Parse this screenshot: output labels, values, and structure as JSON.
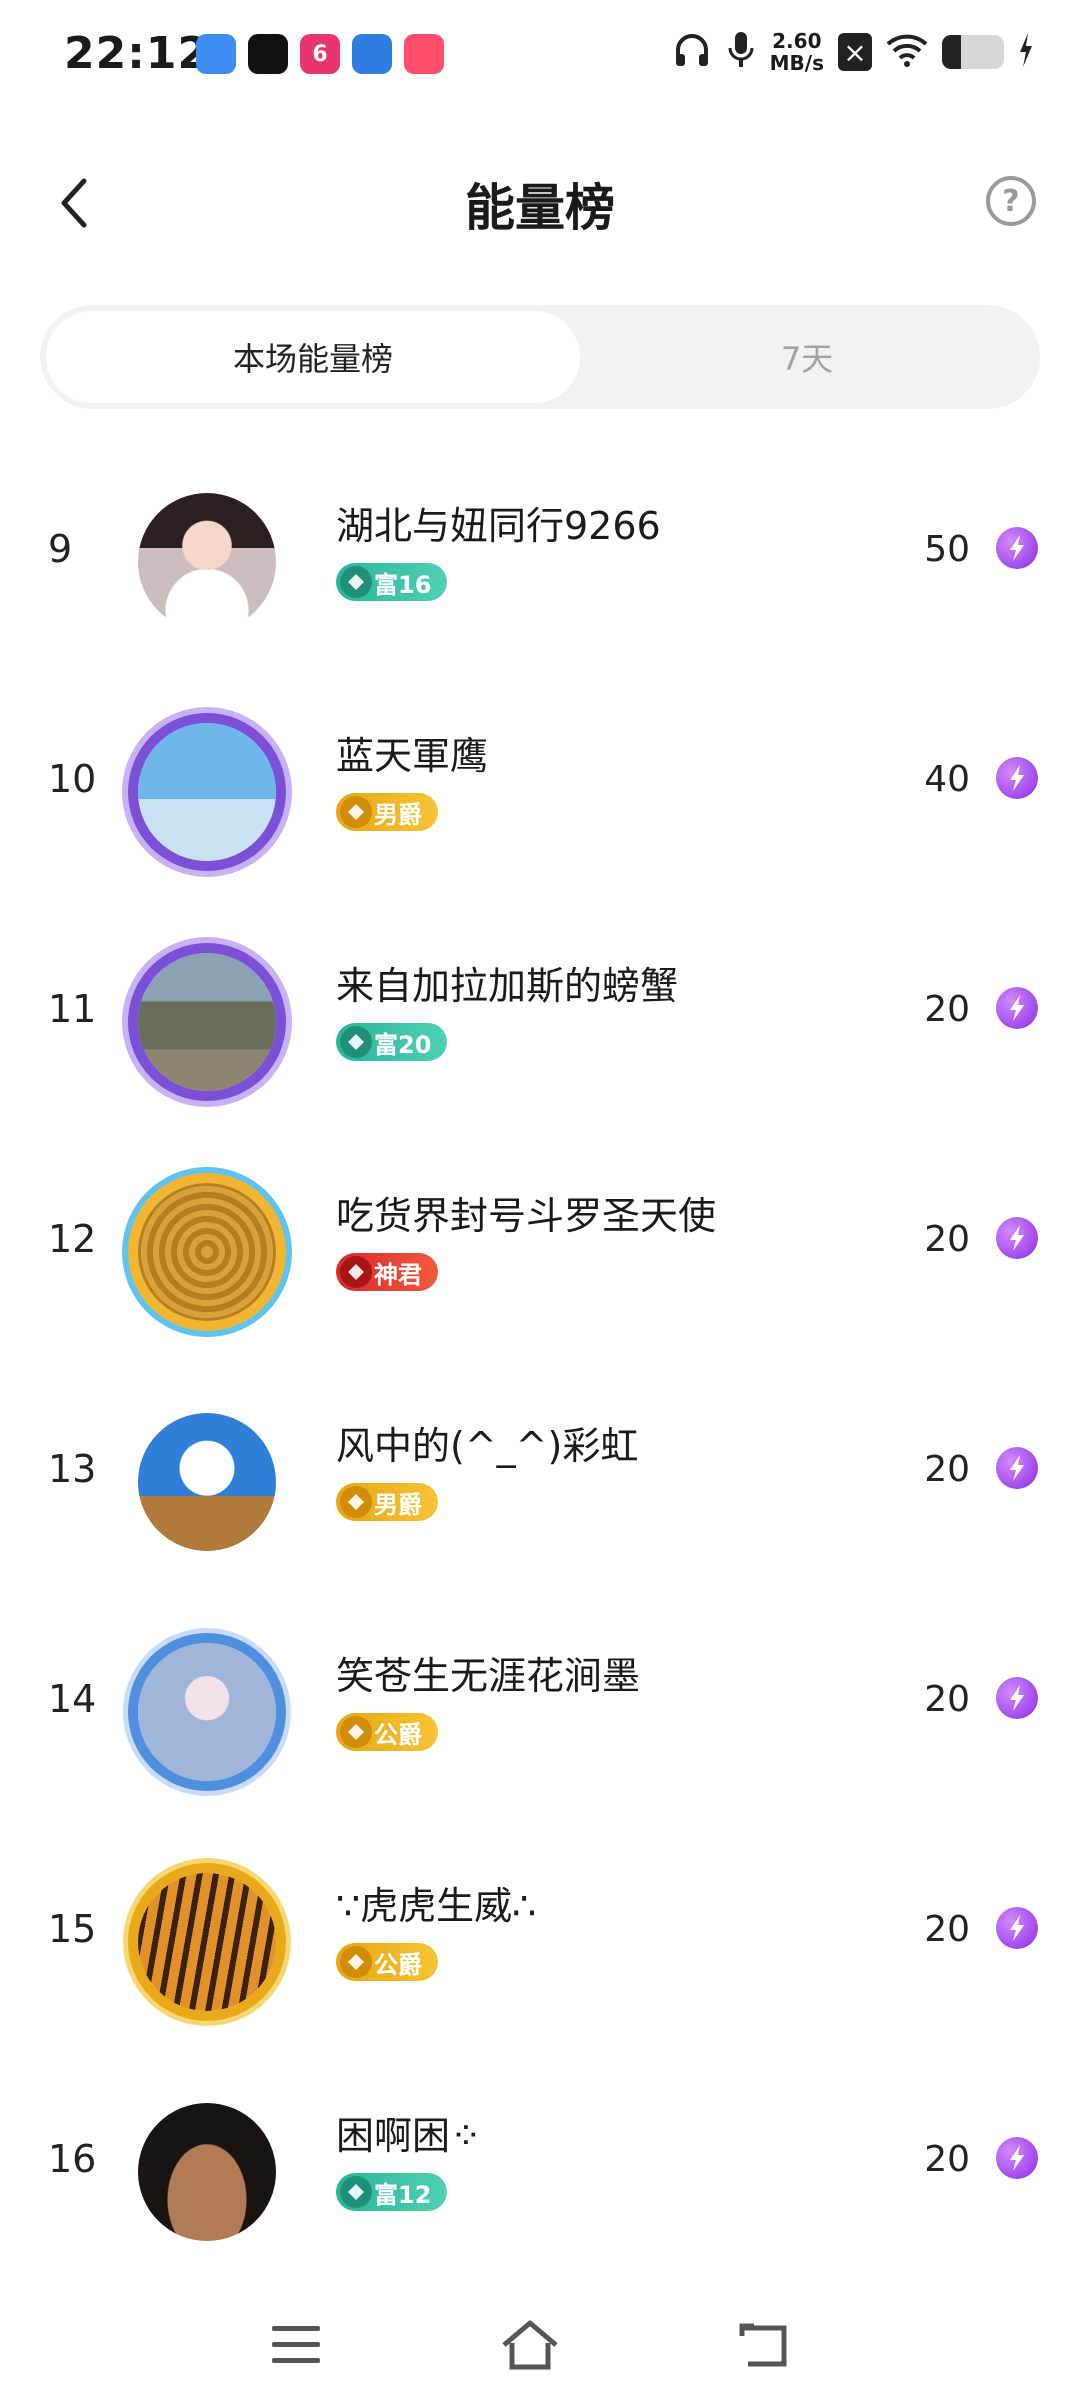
{
  "status_bar": {
    "time": "22:12",
    "apps": [
      {
        "icon": "files-app-icon",
        "color": "#3d8ef0"
      },
      {
        "icon": "tiktok-app-icon",
        "color": "#111111"
      },
      {
        "icon": "six-app-icon",
        "color": "#e8356d",
        "glyph": "6"
      },
      {
        "icon": "browser-app-icon",
        "color": "#2f7de1"
      },
      {
        "icon": "video-app-icon",
        "color": "#ff4d6a"
      }
    ],
    "net_speed_value": "2.60",
    "net_speed_unit": "MB/s",
    "battery_level": 0.3
  },
  "header": {
    "title": "能量榜",
    "help_label": "?"
  },
  "tabs": [
    {
      "label": "本场能量榜",
      "active": true
    },
    {
      "label": "7天",
      "active": false
    }
  ],
  "entries": [
    {
      "rank": "9",
      "name": "湖北与妞同行9266",
      "badge": "富16",
      "badge_type": "rich",
      "score": "50",
      "avatar": "avatar-girl",
      "frame": "none"
    },
    {
      "rank": "10",
      "name": "蓝天軍鹰",
      "badge": "男爵",
      "badge_type": "noble",
      "score": "40",
      "avatar": "avatar-jet",
      "frame": "purple"
    },
    {
      "rank": "11",
      "name": "来自加拉加斯的螃蟹",
      "badge": "富20",
      "badge_type": "rich",
      "score": "20",
      "avatar": "avatar-landscape",
      "frame": "purple"
    },
    {
      "rank": "12",
      "name": "吃货界封号斗罗圣天使",
      "badge": "神君",
      "badge_type": "god",
      "score": "20",
      "avatar": "avatar-food",
      "frame": "gold-blue"
    },
    {
      "rank": "13",
      "name": "风中的(^_^)彩虹",
      "badge": "男爵",
      "badge_type": "noble",
      "score": "20",
      "avatar": "avatar-sky",
      "frame": "none"
    },
    {
      "rank": "14",
      "name": "笑苍生无涯花涧墨",
      "badge": "公爵",
      "badge_type": "noble",
      "score": "20",
      "avatar": "avatar-anime",
      "frame": "blue"
    },
    {
      "rank": "15",
      "name": "∵虎虎生威∴",
      "badge": "公爵",
      "badge_type": "noble",
      "score": "20",
      "avatar": "avatar-tiger",
      "frame": "gold"
    },
    {
      "rank": "16",
      "name": "困啊困⁘",
      "badge": "富12",
      "badge_type": "rich",
      "score": "20",
      "avatar": "avatar-muscle",
      "frame": "none"
    }
  ]
}
